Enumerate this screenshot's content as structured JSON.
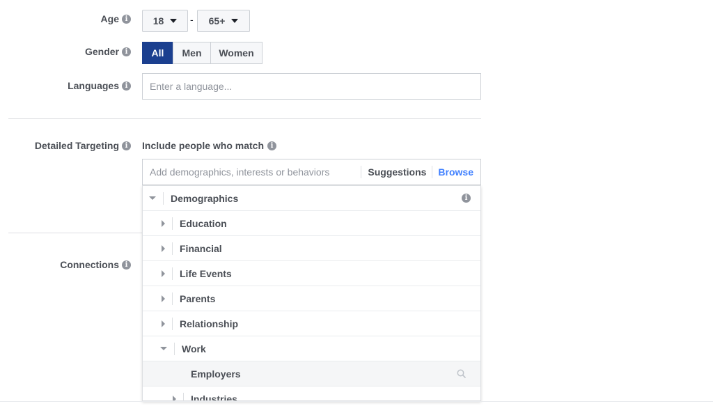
{
  "age": {
    "label": "Age",
    "min": "18",
    "separator": "-",
    "max": "65+"
  },
  "gender": {
    "label": "Gender",
    "options": [
      "All",
      "Men",
      "Women"
    ],
    "selected": "All"
  },
  "languages": {
    "label": "Languages",
    "placeholder": "Enter a language..."
  },
  "detailed_targeting": {
    "label": "Detailed Targeting",
    "include_label": "Include people who match",
    "placeholder": "Add demographics, interests or behaviors",
    "suggestions_label": "Suggestions",
    "browse_label": "Browse"
  },
  "connections": {
    "label": "Connections"
  },
  "browse_tree": {
    "root": "Demographics",
    "items": [
      "Education",
      "Financial",
      "Life Events",
      "Parents",
      "Relationship",
      "Work"
    ],
    "expanded_item": "Work",
    "sub_items": [
      "Employers",
      "Industries"
    ]
  },
  "colors": {
    "accent": "#1b3f8f",
    "link": "#4080ff"
  }
}
